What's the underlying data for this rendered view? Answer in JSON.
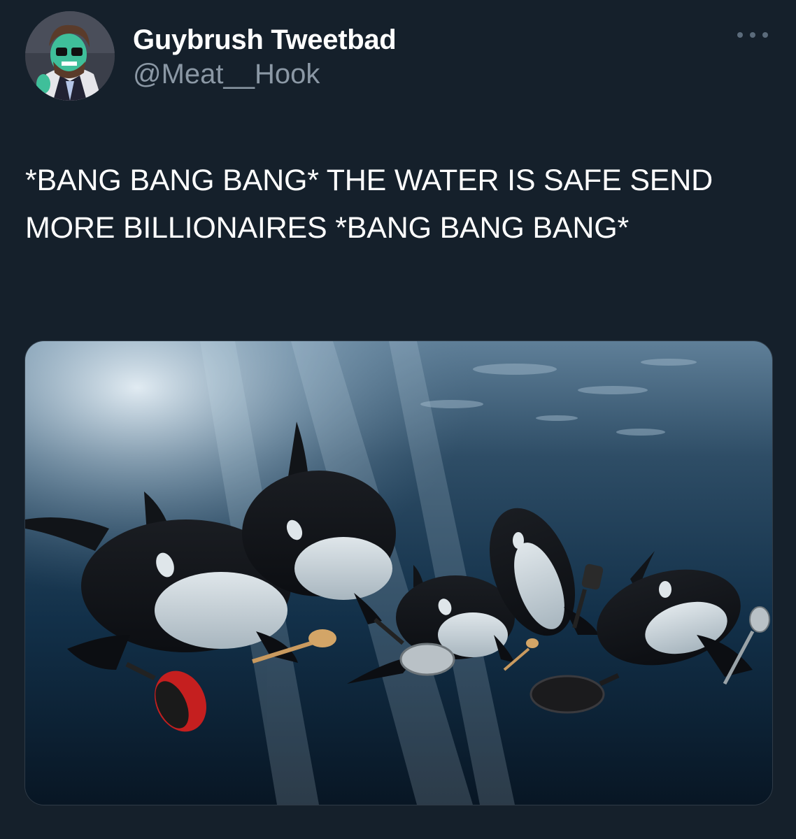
{
  "author": {
    "display_name": "Guybrush Tweetbad",
    "handle": "@Meat__Hook"
  },
  "tweet": {
    "text": "*BANG BANG BANG* THE WATER IS SAFE SEND MORE BILLIONAIRES *BANG BANG BANG*"
  },
  "media": {
    "subjects": [
      "orca",
      "orca",
      "orca",
      "orca",
      "orca"
    ],
    "props": [
      "red-saucepan-icon",
      "wooden-spoon-icon",
      "frying-pan-icon",
      "wooden-spoon-icon",
      "spatula-icon",
      "cast-iron-skillet-icon",
      "slotted-spoon-icon"
    ]
  },
  "colors": {
    "background": "#15202b",
    "secondary_text": "#8b98a5",
    "water_deep": "#0b1b2b",
    "water_light": "#5f7f98"
  }
}
